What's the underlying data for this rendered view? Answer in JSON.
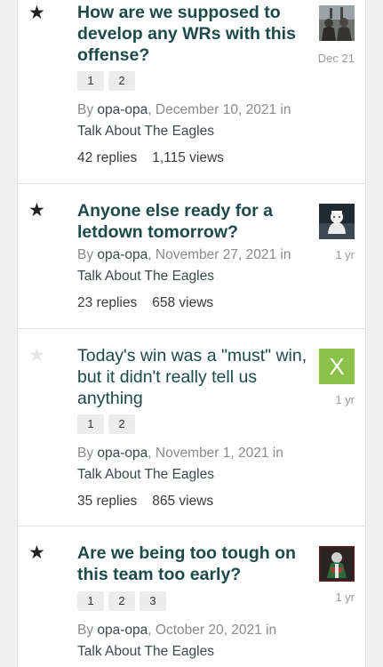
{
  "topics": [
    {
      "title": "How are we supposed to develop any WRs with this offense?",
      "pages": [
        "1",
        "2"
      ],
      "by": "By",
      "author": "opa-opa",
      "date": "December 10, 2021",
      "in": "in",
      "forum": "Talk About The Eagles",
      "replies": "42 replies",
      "views": "1,115 views",
      "ago": "Dec 21",
      "starred": true,
      "unread": true
    },
    {
      "title": "Anyone else ready for a letdown tomorrow?",
      "pages": [],
      "by": "By",
      "author": "opa-opa",
      "date": "November 27, 2021",
      "in": "in",
      "forum": "Talk About The Eagles",
      "replies": "23 replies",
      "views": "658 views",
      "ago": "1 yr",
      "starred": true,
      "unread": true
    },
    {
      "title": "Today's win was a \"must\" win, but it didn't really tell us anything",
      "pages": [
        "1",
        "2"
      ],
      "by": "By",
      "author": "opa-opa",
      "date": "November 1, 2021",
      "in": "in",
      "forum": "Talk About The Eagles",
      "replies": "35 replies",
      "views": "865 views",
      "ago": "1 yr",
      "avatar_letter": "X",
      "starred": false,
      "unread": false
    },
    {
      "title": "Are we being too tough on this team too early?",
      "pages": [
        "1",
        "2",
        "3"
      ],
      "by": "By",
      "author": "opa-opa",
      "date": "October 20, 2021",
      "in": "in",
      "forum": "Talk About The Eagles",
      "ago": "1 yr",
      "starred": true,
      "unread": true
    }
  ],
  "icons": {
    "star": "star-icon"
  },
  "colors": {
    "title": "#1c4a4a",
    "avatar_x": "#8bc34a",
    "star_on": "#222222",
    "star_off": "#e6e6e6"
  }
}
